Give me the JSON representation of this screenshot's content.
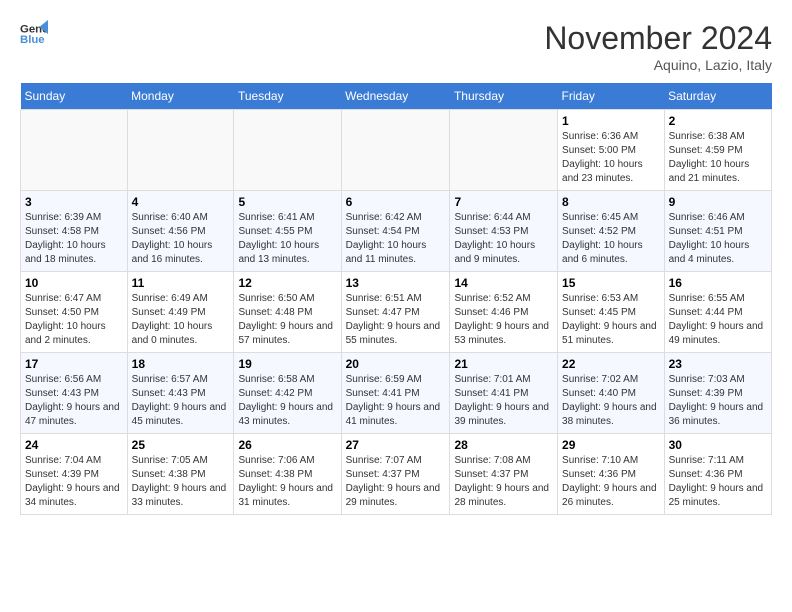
{
  "logo": {
    "text1": "General",
    "text2": "Blue"
  },
  "title": "November 2024",
  "location": "Aquino, Lazio, Italy",
  "days_of_week": [
    "Sunday",
    "Monday",
    "Tuesday",
    "Wednesday",
    "Thursday",
    "Friday",
    "Saturday"
  ],
  "weeks": [
    [
      {
        "day": "",
        "info": ""
      },
      {
        "day": "",
        "info": ""
      },
      {
        "day": "",
        "info": ""
      },
      {
        "day": "",
        "info": ""
      },
      {
        "day": "",
        "info": ""
      },
      {
        "day": "1",
        "info": "Sunrise: 6:36 AM\nSunset: 5:00 PM\nDaylight: 10 hours and 23 minutes."
      },
      {
        "day": "2",
        "info": "Sunrise: 6:38 AM\nSunset: 4:59 PM\nDaylight: 10 hours and 21 minutes."
      }
    ],
    [
      {
        "day": "3",
        "info": "Sunrise: 6:39 AM\nSunset: 4:58 PM\nDaylight: 10 hours and 18 minutes."
      },
      {
        "day": "4",
        "info": "Sunrise: 6:40 AM\nSunset: 4:56 PM\nDaylight: 10 hours and 16 minutes."
      },
      {
        "day": "5",
        "info": "Sunrise: 6:41 AM\nSunset: 4:55 PM\nDaylight: 10 hours and 13 minutes."
      },
      {
        "day": "6",
        "info": "Sunrise: 6:42 AM\nSunset: 4:54 PM\nDaylight: 10 hours and 11 minutes."
      },
      {
        "day": "7",
        "info": "Sunrise: 6:44 AM\nSunset: 4:53 PM\nDaylight: 10 hours and 9 minutes."
      },
      {
        "day": "8",
        "info": "Sunrise: 6:45 AM\nSunset: 4:52 PM\nDaylight: 10 hours and 6 minutes."
      },
      {
        "day": "9",
        "info": "Sunrise: 6:46 AM\nSunset: 4:51 PM\nDaylight: 10 hours and 4 minutes."
      }
    ],
    [
      {
        "day": "10",
        "info": "Sunrise: 6:47 AM\nSunset: 4:50 PM\nDaylight: 10 hours and 2 minutes."
      },
      {
        "day": "11",
        "info": "Sunrise: 6:49 AM\nSunset: 4:49 PM\nDaylight: 10 hours and 0 minutes."
      },
      {
        "day": "12",
        "info": "Sunrise: 6:50 AM\nSunset: 4:48 PM\nDaylight: 9 hours and 57 minutes."
      },
      {
        "day": "13",
        "info": "Sunrise: 6:51 AM\nSunset: 4:47 PM\nDaylight: 9 hours and 55 minutes."
      },
      {
        "day": "14",
        "info": "Sunrise: 6:52 AM\nSunset: 4:46 PM\nDaylight: 9 hours and 53 minutes."
      },
      {
        "day": "15",
        "info": "Sunrise: 6:53 AM\nSunset: 4:45 PM\nDaylight: 9 hours and 51 minutes."
      },
      {
        "day": "16",
        "info": "Sunrise: 6:55 AM\nSunset: 4:44 PM\nDaylight: 9 hours and 49 minutes."
      }
    ],
    [
      {
        "day": "17",
        "info": "Sunrise: 6:56 AM\nSunset: 4:43 PM\nDaylight: 9 hours and 47 minutes."
      },
      {
        "day": "18",
        "info": "Sunrise: 6:57 AM\nSunset: 4:43 PM\nDaylight: 9 hours and 45 minutes."
      },
      {
        "day": "19",
        "info": "Sunrise: 6:58 AM\nSunset: 4:42 PM\nDaylight: 9 hours and 43 minutes."
      },
      {
        "day": "20",
        "info": "Sunrise: 6:59 AM\nSunset: 4:41 PM\nDaylight: 9 hours and 41 minutes."
      },
      {
        "day": "21",
        "info": "Sunrise: 7:01 AM\nSunset: 4:41 PM\nDaylight: 9 hours and 39 minutes."
      },
      {
        "day": "22",
        "info": "Sunrise: 7:02 AM\nSunset: 4:40 PM\nDaylight: 9 hours and 38 minutes."
      },
      {
        "day": "23",
        "info": "Sunrise: 7:03 AM\nSunset: 4:39 PM\nDaylight: 9 hours and 36 minutes."
      }
    ],
    [
      {
        "day": "24",
        "info": "Sunrise: 7:04 AM\nSunset: 4:39 PM\nDaylight: 9 hours and 34 minutes."
      },
      {
        "day": "25",
        "info": "Sunrise: 7:05 AM\nSunset: 4:38 PM\nDaylight: 9 hours and 33 minutes."
      },
      {
        "day": "26",
        "info": "Sunrise: 7:06 AM\nSunset: 4:38 PM\nDaylight: 9 hours and 31 minutes."
      },
      {
        "day": "27",
        "info": "Sunrise: 7:07 AM\nSunset: 4:37 PM\nDaylight: 9 hours and 29 minutes."
      },
      {
        "day": "28",
        "info": "Sunrise: 7:08 AM\nSunset: 4:37 PM\nDaylight: 9 hours and 28 minutes."
      },
      {
        "day": "29",
        "info": "Sunrise: 7:10 AM\nSunset: 4:36 PM\nDaylight: 9 hours and 26 minutes."
      },
      {
        "day": "30",
        "info": "Sunrise: 7:11 AM\nSunset: 4:36 PM\nDaylight: 9 hours and 25 minutes."
      }
    ]
  ]
}
